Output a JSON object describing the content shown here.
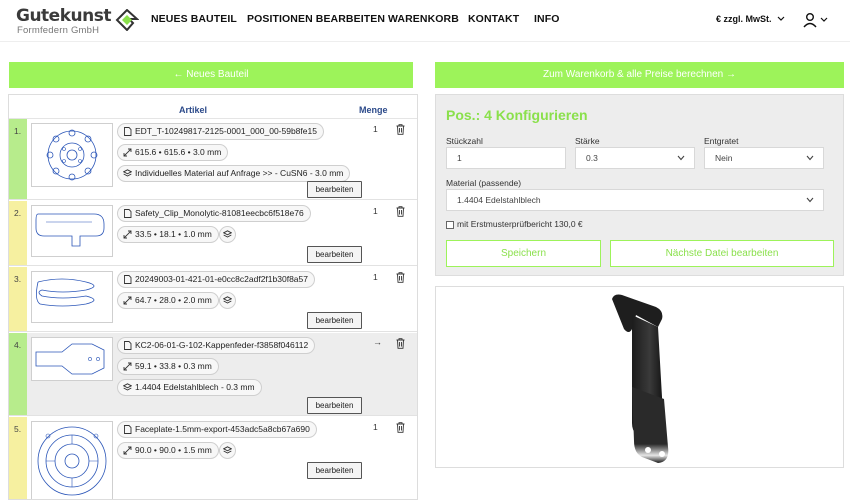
{
  "header": {
    "logo_main": "Gutekunst",
    "logo_sub": "Formfedern GmbH",
    "nav": [
      {
        "label": "NEUES BAUTEIL"
      },
      {
        "label": "POSITIONEN BEARBEITEN"
      },
      {
        "label": "WARENKORB"
      },
      {
        "label": "KONTAKT"
      },
      {
        "label": "INFO"
      }
    ],
    "currency": "€ zzgl. MwSt.",
    "icons": [
      "logo-mark-icon",
      "chevron-down-icon",
      "user-icon"
    ]
  },
  "actions": {
    "back_label": "← Neues Bauteil",
    "cart_label": "Zum Warenkorb & alle Preise berechnen →"
  },
  "list": {
    "col_artikel": "Artikel",
    "col_menge": "Menge",
    "edit_label": "bearbeiten",
    "items": [
      {
        "num": "1.",
        "filename": "EDT_T-10249817-2125-0001_000_00-59b8fe15",
        "dims": "615.6 • 615.6 • 3.0 mm",
        "material": "Individuelles Material auf Anfrage >> - CuSN6 - 3.0 mm",
        "qty": "1",
        "status_color": "#b7ec8c"
      },
      {
        "num": "2.",
        "filename": "Safety_Clip_Monolytic-81081eecbc6f518e76",
        "dims": "33.5 • 18.1 • 1.0 mm",
        "material": "",
        "qty": "1",
        "status_color": "#f6f0a0"
      },
      {
        "num": "3.",
        "filename": "20249003-01-421-01-e0cc8c2adf2f1b30f8a57",
        "dims": "64.7 • 28.0 • 2.0 mm",
        "material": "",
        "qty": "1",
        "status_color": "#f6f0a0"
      },
      {
        "num": "4.",
        "filename": "KC2-06-01-G-102-Kappenfeder-f3858f046112",
        "dims": "59.1 • 33.8 • 0.3 mm",
        "material": "1.4404 Edelstahlblech - 0.3 mm",
        "qty": "→",
        "status_color": "#b7ec8c"
      },
      {
        "num": "5.",
        "filename": "Faceplate-1.5mm-export-453adc5a8cb67a690",
        "dims": "90.0 • 90.0 • 1.5 mm",
        "material": "",
        "qty": "1",
        "status_color": "#f6f0a0"
      }
    ]
  },
  "config": {
    "title": "Pos.: 4 Konfigurieren",
    "stueckzahl_label": "Stückzahl",
    "stueckzahl_value": "1",
    "staerke_label": "Stärke",
    "staerke_value": "0.3",
    "entgratet_label": "Entgratet",
    "entgratet_value": "Nein",
    "material_label": "Material (passende)",
    "material_value": "1.4404 Edelstahlblech",
    "check_label": "mit Erstmusterprüfbericht 130,0 €",
    "save_label": "Speichern",
    "next_label": "Nächste Datei bearbeiten",
    "accent_color": "#9df35a"
  },
  "preview": {
    "icon": "3d-part-preview"
  }
}
